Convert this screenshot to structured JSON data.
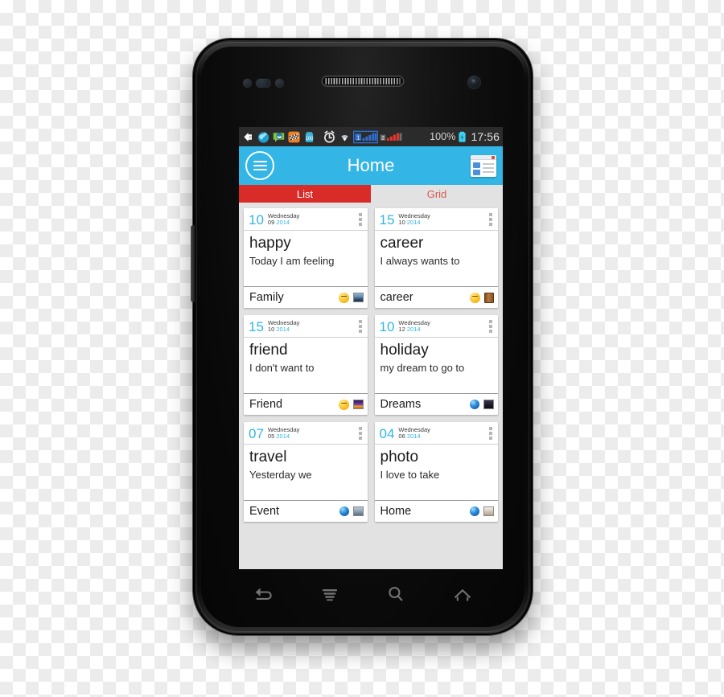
{
  "status_bar": {
    "icons": [
      {
        "name": "download-icon"
      },
      {
        "name": "browser-icon"
      },
      {
        "name": "messaging-icon"
      },
      {
        "name": "checkered-app-icon"
      },
      {
        "name": "battery-saver-icon"
      },
      {
        "name": "alarm-clock-icon"
      },
      {
        "name": "wifi-icon"
      },
      {
        "name": "sim1-signal-icon"
      },
      {
        "name": "sim2-signal-icon"
      }
    ],
    "battery_percent": "100%",
    "battery_icon": "battery-charging-icon",
    "clock": "17:56"
  },
  "header": {
    "drawer_icon": "hamburger-menu-icon",
    "title": "Home",
    "view_toggle_icon": "list-view-window-icon"
  },
  "tabs": [
    {
      "label": "List",
      "active": true
    },
    {
      "label": "Grid",
      "active": false
    }
  ],
  "cards": [
    {
      "day": "10",
      "weekday": "Wednesday",
      "month": "09",
      "year": "2014",
      "title": "happy",
      "snippet": "Today I am feeling",
      "category": "Family",
      "overflow_icon": "overflow-menu-icon",
      "icons": [
        {
          "name": "smiley-emoji-icon",
          "type": "emoji"
        },
        {
          "name": "photo-thumbnail-icon",
          "type": "photo-city"
        }
      ]
    },
    {
      "day": "15",
      "weekday": "Wednesday",
      "month": "10",
      "year": "2014",
      "title": "career",
      "snippet": "I always wants to",
      "category": "career",
      "overflow_icon": "overflow-menu-icon",
      "icons": [
        {
          "name": "smiley-emoji-icon",
          "type": "emoji"
        },
        {
          "name": "book-icon",
          "type": "book"
        }
      ]
    },
    {
      "day": "15",
      "weekday": "Wednesday",
      "month": "10",
      "year": "2014",
      "title": "friend",
      "snippet": "I don't want to",
      "category": "Friend",
      "overflow_icon": "overflow-menu-icon",
      "icons": [
        {
          "name": "smiley-emoji-icon",
          "type": "emoji"
        },
        {
          "name": "photo-thumbnail-icon",
          "type": "photo-fire"
        }
      ]
    },
    {
      "day": "10",
      "weekday": "Wednesday",
      "month": "12",
      "year": "2014",
      "title": "holiday",
      "snippet": "my dream to go to",
      "category": "Dreams",
      "overflow_icon": "overflow-menu-icon",
      "icons": [
        {
          "name": "globe-icon",
          "type": "globe"
        },
        {
          "name": "photo-thumbnail-icon",
          "type": "photo-dark"
        }
      ]
    },
    {
      "day": "07",
      "weekday": "Wednesday",
      "month": "05",
      "year": "2014",
      "title": "travel",
      "snippet": "Yesterday we",
      "category": "Event",
      "overflow_icon": "overflow-menu-icon",
      "icons": [
        {
          "name": "globe-icon",
          "type": "globe"
        },
        {
          "name": "photo-thumbnail-icon",
          "type": "photo-temple"
        }
      ]
    },
    {
      "day": "04",
      "weekday": "Wednesday",
      "month": "06",
      "year": "2014",
      "title": "photo",
      "snippet": "I love to take",
      "category": "Home",
      "overflow_icon": "overflow-menu-icon",
      "icons": [
        {
          "name": "globe-icon",
          "type": "globe"
        },
        {
          "name": "photo-thumbnail-icon",
          "type": "photo-light"
        }
      ]
    }
  ],
  "soft_keys": [
    {
      "name": "back-button-icon"
    },
    {
      "name": "menu-button-icon"
    },
    {
      "name": "search-button-icon"
    },
    {
      "name": "home-button-icon"
    }
  ],
  "colors": {
    "accent_blue": "#33b5e5",
    "tab_active_red": "#d92b27",
    "tab_inactive_text": "#d9584f",
    "screen_background": "#e2e2e2",
    "status_bar": "#2b2b2b"
  }
}
